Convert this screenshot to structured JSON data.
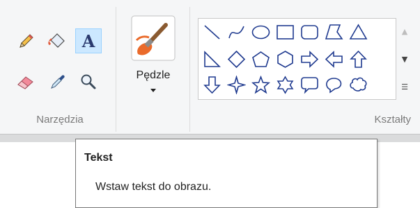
{
  "groups": {
    "tools": {
      "label": "Narzędzia"
    },
    "brushes": {
      "label": "Pędzle"
    },
    "shapes": {
      "label": "Kształty"
    }
  },
  "tools": [
    {
      "name": "pencil-icon",
      "selected": false
    },
    {
      "name": "fill-bucket-icon",
      "selected": false
    },
    {
      "name": "text-tool-icon",
      "glyph": "A",
      "selected": true
    },
    {
      "name": "eraser-icon",
      "selected": false
    },
    {
      "name": "color-picker-icon",
      "selected": false
    },
    {
      "name": "magnifier-icon",
      "selected": false
    }
  ],
  "shapes": [
    "line",
    "curve",
    "oval",
    "rectangle",
    "rounded-rectangle",
    "polygon",
    "triangle",
    "right-triangle",
    "diamond",
    "pentagon",
    "hexagon",
    "right-arrow",
    "left-arrow",
    "up-arrow",
    "down-arrow",
    "four-point-star",
    "five-point-star",
    "six-point-star",
    "rounded-callout",
    "oval-callout",
    "cloud-callout"
  ],
  "tooltip": {
    "title": "Tekst",
    "description": "Wstaw tekst do obrazu."
  },
  "colors": {
    "ribbon_bg": "#f5f6f7",
    "selected_bg": "#cce8ff",
    "shape_stroke": "#1f3a8f",
    "group_label": "#7a7a7a"
  }
}
